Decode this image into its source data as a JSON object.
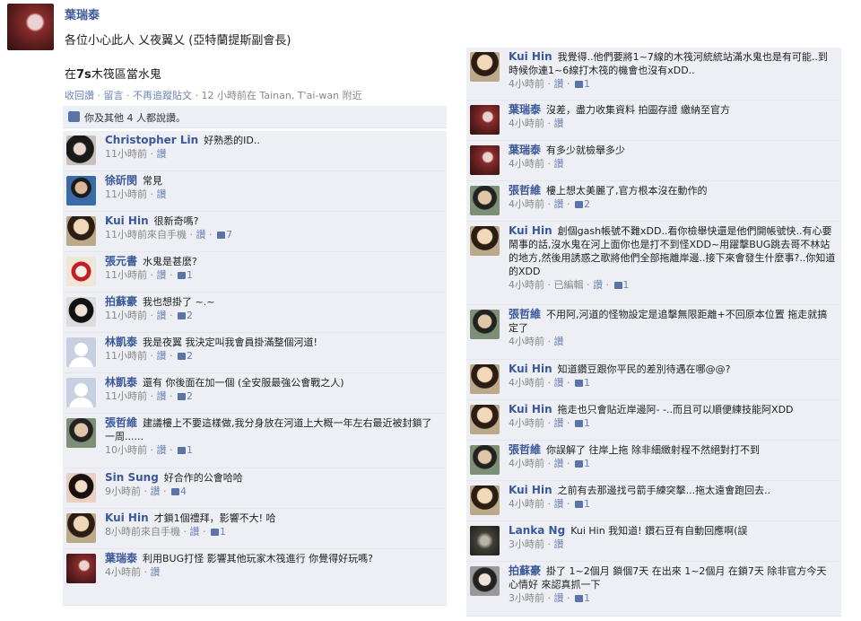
{
  "post": {
    "author": "葉瑞泰",
    "text1": "各位小心此人 乂夜翼乂 (亞特蘭提斯副會長)",
    "text2_prefix": "在",
    "text2_bold": "7s",
    "text2_suffix": "木筏區當水鬼",
    "meta": {
      "like": "收回讚",
      "comment": "留言",
      "unfollow": "不再追蹤貼文",
      "time": "12 小時前在 Tainan, T'ai-wan 附近"
    }
  },
  "likes_text": "你及其他 4 人都說讚。",
  "comments_left": [
    {
      "name": "Christopher Lin",
      "text": "好熟悉的ID..",
      "time": "11小時前",
      "action": "讚",
      "likes": ""
    },
    {
      "name": "徐斫閔",
      "text": "常見",
      "time": "11小時前",
      "action": "讚",
      "likes": ""
    },
    {
      "name": "Kui Hin",
      "text": "很新奇嗎?",
      "time": "11小時前來自手機",
      "action": "讚",
      "likes": "7"
    },
    {
      "name": "張元書",
      "text": "水鬼是甚麼?",
      "time": "11小時前",
      "action": "讚",
      "likes": "1"
    },
    {
      "name": "拍蘇豪",
      "text": "我也想掛了 ~.~",
      "time": "11小時前",
      "action": "讚",
      "likes": "2"
    },
    {
      "name": "林凱泰",
      "text": "我是夜翼 我決定叫我會員掛滿整個河道!",
      "time": "11小時前",
      "action": "讚",
      "likes": "2"
    },
    {
      "name": "林凱泰",
      "text": "還有 你後面在加一個 (全安服最強公會戰之人)",
      "time": "11小時前",
      "action": "讚",
      "likes": "2"
    },
    {
      "name": "張哲維",
      "text": "建議樓上不要這樣做,我分身放在河道上大概一年左右最近被封鎖了一周......",
      "time": "10小時前",
      "action": "讚",
      "likes": "1"
    },
    {
      "name": "Sin Sung",
      "text": "好合作的公會哈哈",
      "time": "9小時前",
      "action": "讚",
      "likes": "4"
    },
    {
      "name": "Kui Hin",
      "text": "才鎖1個禮拜，影響不大! 哈",
      "time": "8小時前來自手機",
      "action": "讚",
      "likes": "1"
    },
    {
      "name": "葉瑞泰",
      "text": "利用BUG打怪 影響其他玩家木筏進行 你覺得好玩嗎?",
      "time": "4小時前",
      "action": "讚",
      "likes": ""
    }
  ],
  "comments_right": [
    {
      "name": "Kui Hin",
      "text": "我覺得..他們要將1~7線的木筏河統統站滿水鬼也是有可能..到時候你連1~6線打木筏的機會也沒有xDD..",
      "time": "4小時前",
      "action": "讚",
      "likes": "1"
    },
    {
      "name": "葉瑞泰",
      "text": "沒差，盡力收集資料 拍圖存證 繳納至官方",
      "time": "4小時前",
      "action": "讚",
      "likes": ""
    },
    {
      "name": "葉瑞泰",
      "text": "有多少就檢舉多少",
      "time": "4小時前",
      "action": "讚",
      "likes": ""
    },
    {
      "name": "張哲維",
      "text": "樓上想太美麗了,官方根本沒在動作的",
      "time": "4小時前",
      "action": "讚",
      "likes": "2"
    },
    {
      "name": "Kui Hin",
      "text": "創個gash帳號不難xDD..看你檢舉快還是他們開帳號快..有心要鬧事的話,沒水鬼在河上面你也是打不到怪XDD~用躍擊BUG跳去哥不林站的地方,然後用誘惑之歌將他們全部拖離岸邊..接下來會發生什麼事?..你知道的XDD",
      "time": "4小時前",
      "edited": "已編輯",
      "action": "讚",
      "likes": "1"
    },
    {
      "name": "張哲維",
      "text": "不用阿,河道的怪物設定是追擊無限距離+不回原本位置 拖走就搞定了",
      "time": "4小時前",
      "action": "讚",
      "likes": ""
    },
    {
      "name": "Kui Hin",
      "text": "知道鑽豆跟你平民的差別待遇在哪@@?",
      "time": "4小時前",
      "action": "讚",
      "likes": "1"
    },
    {
      "name": "Kui Hin",
      "text": "拖走也只會貼近岸邊阿- -..而且可以順便練技能阿XDD",
      "time": "4小時前",
      "action": "讚",
      "likes": "1"
    },
    {
      "name": "張哲維",
      "text": "你誤解了 往岸上拖 除非細緻射程不然絕對打不到",
      "time": "4小時前",
      "action": "讚",
      "likes": "1"
    },
    {
      "name": "Kui Hin",
      "text": "之前有去那邊找弓箭手練突擊...拖太遠會跑回去..",
      "time": "4小時前",
      "action": "讚",
      "likes": "1"
    },
    {
      "name": "Lanka Ng",
      "text": "Kui Hin 我知道! 鑽石豆有自動回應啊(誤",
      "time": "3小時前",
      "action": "讚",
      "likes": ""
    },
    {
      "name": "拍蘇豪",
      "text": "掛了 1~2個月 鎖個7天 在出來 1~2個月 在鎖7天 除非官方今天心情好 來認真抓一下",
      "time": "3小時前",
      "action": "讚",
      "likes": "1"
    }
  ]
}
